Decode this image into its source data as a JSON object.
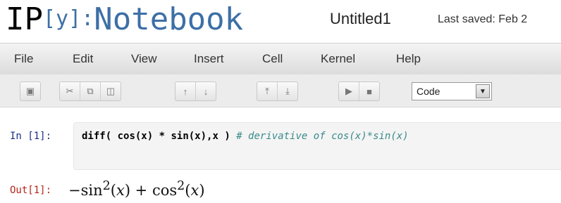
{
  "header": {
    "logo_ip": "IP",
    "logo_py": "[y]:",
    "logo_notebook": "Notebook",
    "notebook_name": "Untitled1",
    "last_saved": "Last saved: Feb 2"
  },
  "menu": [
    "File",
    "Edit",
    "View",
    "Insert",
    "Cell",
    "Kernel",
    "Help"
  ],
  "toolbar": {
    "icons": [
      "save-icon",
      "cut-icon",
      "copy-icon",
      "paste-icon",
      "move-up-icon",
      "move-down-icon",
      "insert-above-icon",
      "insert-below-icon",
      "run-icon",
      "stop-icon"
    ],
    "cell_type": "Code"
  },
  "cells": {
    "input_prompt": "In [1]:",
    "code_tokens": [
      "diff(",
      " cos(x)",
      " * ",
      "sin(x),x",
      " ) "
    ],
    "comment": "# derivative of cos(x)*sin(x)",
    "output_prompt": "Out[1]:",
    "output_parts": [
      "−sin",
      "2",
      "(",
      "x",
      ") + cos",
      "2",
      "(",
      "x",
      ")"
    ]
  }
}
